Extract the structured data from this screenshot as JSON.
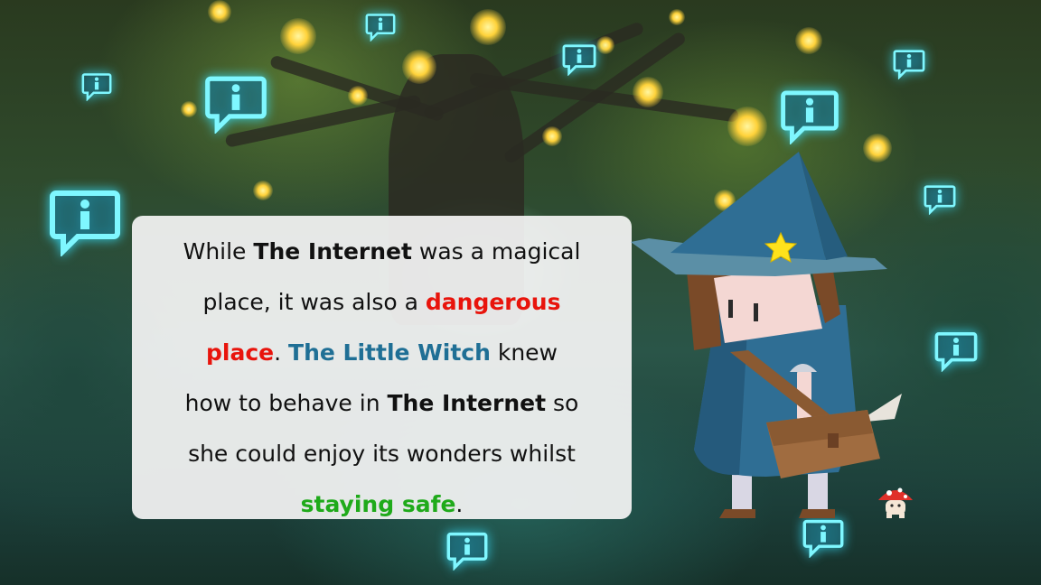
{
  "story": {
    "lines": [
      [
        {
          "t": "While ",
          "s": "n"
        },
        {
          "t": "The Internet",
          "s": "k"
        },
        {
          "t": " was a magical",
          "s": "n"
        }
      ],
      [
        {
          "t": "place, it was also a ",
          "s": "n"
        },
        {
          "t": "dangerous",
          "s": "danger"
        }
      ],
      [
        {
          "t": "place",
          "s": "danger"
        },
        {
          "t": ". ",
          "s": "n"
        },
        {
          "t": "The Little Witch",
          "s": "witch"
        },
        {
          "t": " knew",
          "s": "n"
        }
      ],
      [
        {
          "t": "how to behave in ",
          "s": "n"
        },
        {
          "t": "The Internet",
          "s": "k"
        },
        {
          "t": " so",
          "s": "n"
        }
      ],
      [
        {
          "t": "she could enjoy its wonders whilst",
          "s": "n"
        }
      ],
      [
        {
          "t": "staying safe",
          "s": "safe"
        },
        {
          "t": ".",
          "s": "n"
        }
      ]
    ]
  },
  "colors": {
    "keyword": "#111111",
    "danger": "#e8140c",
    "witch_name": "#1f6f95",
    "safe": "#1faa1a",
    "info_icon": "#7ff7ff",
    "hat": "#2f6e94",
    "star": "#ffe21c"
  },
  "icons": {
    "info_bubble": "info-bubble-icon",
    "star": "star-icon",
    "mushroom": "mushroom-icon"
  }
}
